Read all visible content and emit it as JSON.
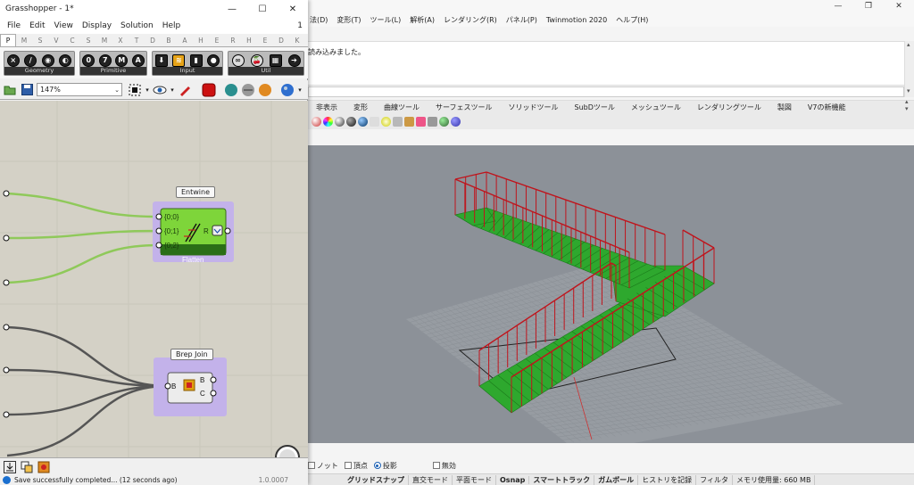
{
  "rhino": {
    "menu": [
      "法(D)",
      "変形(T)",
      "ツール(L)",
      "解析(A)",
      "レンダリング(R)",
      "パネル(P)",
      "Twinmotion 2020",
      "ヘルプ(H)"
    ],
    "command_history": "読み込みました。",
    "tabs": [
      "非表示",
      "変形",
      "曲線ツール",
      "サーフェスツール",
      "ソリッドツール",
      "SubDツール",
      "メッシュツール",
      "レンダリングツール",
      "製図",
      "V7の新機能"
    ],
    "osnap": {
      "items": [
        {
          "label": "ノット",
          "checked": false
        },
        {
          "label": "頂点",
          "checked": false
        },
        {
          "label": "投影",
          "radio": true
        },
        {
          "label": "無効",
          "checked": false
        }
      ]
    },
    "status": [
      "グリッドスナップ",
      "直交モード",
      "平面モード",
      "Osnap",
      "スマートトラック",
      "ガムボール",
      "ヒストリを記録",
      "フィルタ",
      "メモリ使用量: 660 MB"
    ],
    "status_bold": [
      "グリッドスナップ",
      "Osnap",
      "スマートトラック",
      "ガムボール"
    ],
    "colors": {
      "stair_green": "#2ea82e",
      "rail_red": "#c0141c",
      "viewport_bg": "#8c9198"
    }
  },
  "gh": {
    "title": "Grasshopper - 1*",
    "menu": [
      "File",
      "Edit",
      "View",
      "Display",
      "Solution",
      "Help"
    ],
    "menu_right": "1",
    "category_tabs": [
      "P",
      "M",
      "S",
      "V",
      "C",
      "S",
      "M",
      "X",
      "T",
      "D",
      "B",
      "A",
      "H",
      "E",
      "R",
      "H",
      "E",
      "D",
      "K"
    ],
    "active_tab": "P",
    "ribbon_groups": [
      {
        "label": "Geometry",
        "icons": [
          "×",
          "∕",
          "◉",
          "◐"
        ]
      },
      {
        "label": "Primitive",
        "icons": [
          "0",
          "7",
          "M",
          "A"
        ]
      },
      {
        "label": "Input",
        "icons": [
          "⬇",
          "≋",
          "▮",
          "●"
        ]
      },
      {
        "label": "Util",
        "icons": [
          "∞",
          "🍒",
          "▦",
          "➔"
        ]
      }
    ],
    "zoom": "147%",
    "components": {
      "entwine": {
        "name": "Entwine",
        "inputs": [
          "{0;0}",
          "{0;1}",
          "{0;2}"
        ],
        "output": "R",
        "footer": "Flatten"
      },
      "brep_join": {
        "name": "Brep Join",
        "inputs": [
          "B"
        ],
        "outputs": [
          "B",
          "C"
        ]
      }
    },
    "status_text": "Save successfully completed... (12 seconds ago)",
    "version": "1.0.0007",
    "colors": {
      "canvas_bg": "#d4d1c6",
      "wire_green": "#8fc95a",
      "wire_dark": "#555555",
      "component_purple": "#c3b2ea",
      "component_green": "#7ed53a"
    }
  }
}
